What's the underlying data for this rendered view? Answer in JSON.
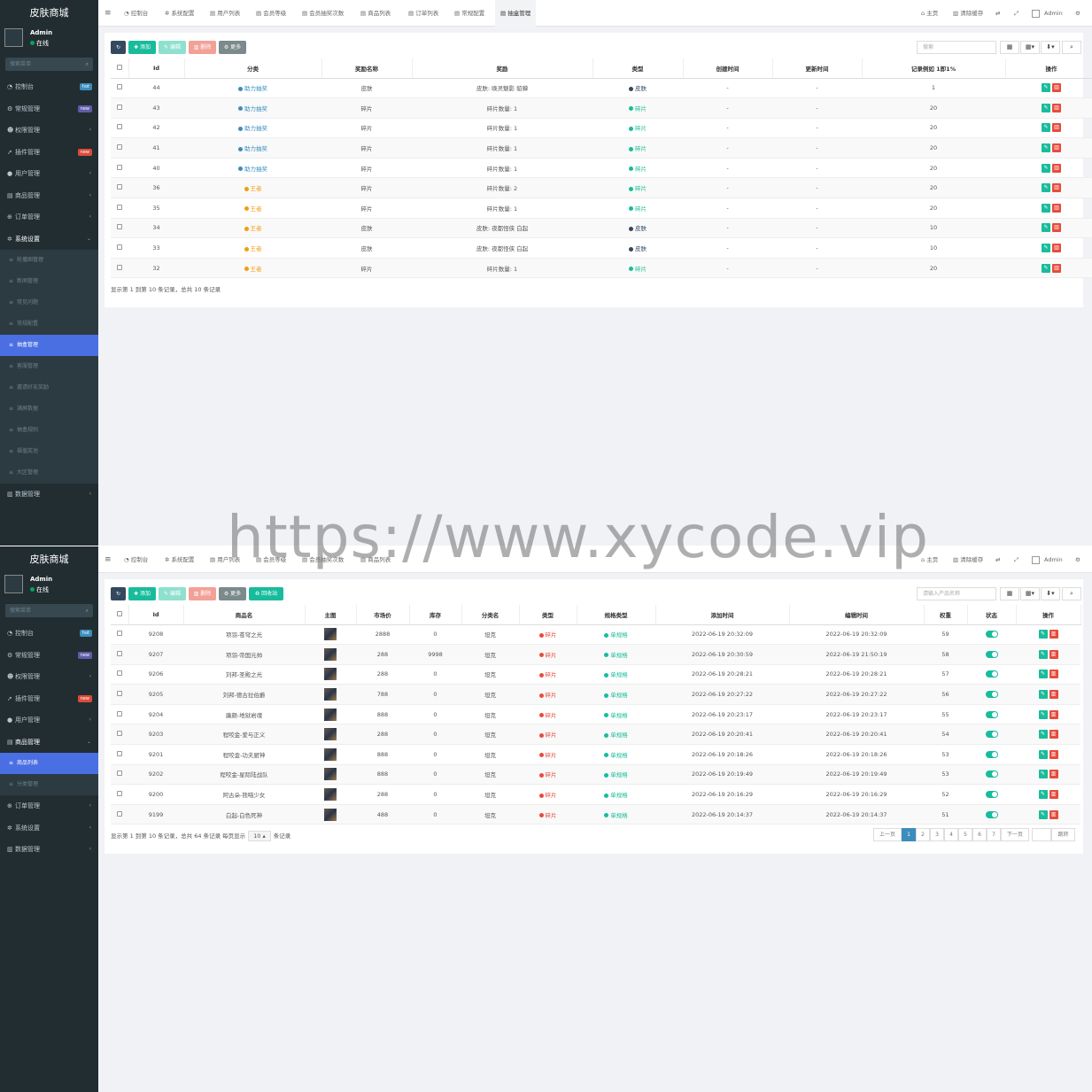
{
  "watermark": "https://www.xycode.vip",
  "colors": {
    "sidebar_bg": "#222d32",
    "active": "#4a6fe3",
    "teal": "#18bc9c",
    "blue": "#3c8dbc",
    "orange": "#f39c12",
    "red": "#e74c3c",
    "dark": "#34495e"
  },
  "p1": {
    "brand": "皮肤商城",
    "user": {
      "name": "Admin",
      "status": "在线"
    },
    "search_placeholder": "搜索菜单",
    "menu": [
      {
        "icon": "dashboard-icon",
        "label": "控制台",
        "badge": "hot",
        "badge_color": "#3c8dbc"
      },
      {
        "icon": "cogs-icon",
        "label": "常规管理",
        "badge": "new",
        "badge_color": "#605ca8"
      },
      {
        "icon": "users-icon",
        "label": "权限管理",
        "chev": "‹"
      },
      {
        "icon": "rocket-icon",
        "label": "插件管理",
        "badge": "new",
        "badge_color": "#dd4b39"
      },
      {
        "icon": "user-icon",
        "label": "用户管理",
        "chev": "‹"
      },
      {
        "icon": "shop-icon",
        "label": "商品管理",
        "chev": "‹"
      },
      {
        "icon": "cart-icon",
        "label": "订单管理",
        "chev": "‹"
      },
      {
        "icon": "gear-icon",
        "label": "系统设置",
        "chev": "⌄",
        "open": true
      }
    ],
    "submenu": [
      "轮播图管理",
      "新闻管理",
      "常见问题",
      "常规配置",
      "抽盒管理",
      "客服管理",
      "邀请好友奖励",
      "满屏数据",
      "抽盒规则",
      "福值奖池",
      "大区管理"
    ],
    "submenu_active": 4,
    "menu_after": [
      {
        "icon": "database-icon",
        "label": "数据管理",
        "chev": "‹"
      }
    ],
    "tabs": [
      "控制台",
      "系统配置",
      "用户列表",
      "会员等级",
      "会员抽奖次数",
      "商品列表",
      "订单列表",
      "常规配置",
      "抽盒管理"
    ],
    "tab_active": 8,
    "topright": {
      "home": "主页",
      "clear": "清除缓存",
      "admin": "Admin"
    },
    "buttons": {
      "add": "添加",
      "edit": "编辑",
      "del": "删除",
      "more": "更多"
    },
    "search_label": "搜索",
    "headers": [
      "Id",
      "分类",
      "奖励名称",
      "奖励",
      "类型",
      "创建时间",
      "更新时间",
      "记录例如 1即1%",
      "操作"
    ],
    "rows": [
      {
        "id": "44",
        "cat": "助力抽奖",
        "cat_color": "#3c8dbc",
        "name": "皮肤",
        "reward": "皮肤: 唤灵魅影 貂蝉",
        "type": "皮肤",
        "type_color": "#34495e",
        "created": "-",
        "updated": "-",
        "rate": "1"
      },
      {
        "id": "43",
        "cat": "助力抽奖",
        "cat_color": "#3c8dbc",
        "name": "碎片",
        "reward": "碎片数量: 1",
        "type": "碎片",
        "type_color": "#18bc9c",
        "created": "-",
        "updated": "-",
        "rate": "20"
      },
      {
        "id": "42",
        "cat": "助力抽奖",
        "cat_color": "#3c8dbc",
        "name": "碎片",
        "reward": "碎片数量: 1",
        "type": "碎片",
        "type_color": "#18bc9c",
        "created": "-",
        "updated": "-",
        "rate": "20"
      },
      {
        "id": "41",
        "cat": "助力抽奖",
        "cat_color": "#3c8dbc",
        "name": "碎片",
        "reward": "碎片数量: 1",
        "type": "碎片",
        "type_color": "#18bc9c",
        "created": "-",
        "updated": "-",
        "rate": "20"
      },
      {
        "id": "40",
        "cat": "助力抽奖",
        "cat_color": "#3c8dbc",
        "name": "碎片",
        "reward": "碎片数量: 1",
        "type": "碎片",
        "type_color": "#18bc9c",
        "created": "-",
        "updated": "-",
        "rate": "20"
      },
      {
        "id": "36",
        "cat": "王者",
        "cat_color": "#f39c12",
        "name": "碎片",
        "reward": "碎片数量: 2",
        "type": "碎片",
        "type_color": "#18bc9c",
        "created": "-",
        "updated": "-",
        "rate": "20"
      },
      {
        "id": "35",
        "cat": "王者",
        "cat_color": "#f39c12",
        "name": "碎片",
        "reward": "碎片数量: 1",
        "type": "碎片",
        "type_color": "#18bc9c",
        "created": "-",
        "updated": "-",
        "rate": "20"
      },
      {
        "id": "34",
        "cat": "王者",
        "cat_color": "#f39c12",
        "name": "皮肤",
        "reward": "皮肤: 夜都怪侠 白起",
        "type": "皮肤",
        "type_color": "#34495e",
        "created": "-",
        "updated": "-",
        "rate": "10"
      },
      {
        "id": "33",
        "cat": "王者",
        "cat_color": "#f39c12",
        "name": "皮肤",
        "reward": "皮肤: 夜都怪侠 白起",
        "type": "皮肤",
        "type_color": "#34495e",
        "created": "-",
        "updated": "-",
        "rate": "10"
      },
      {
        "id": "32",
        "cat": "王者",
        "cat_color": "#f39c12",
        "name": "碎片",
        "reward": "碎片数量: 1",
        "type": "碎片",
        "type_color": "#18bc9c",
        "created": "-",
        "updated": "-",
        "rate": "20"
      }
    ],
    "footer": "显示第 1 到第 10 条记录，总共 10 条记录"
  },
  "p2": {
    "brand": "皮肤商城",
    "user": {
      "name": "Admin",
      "status": "在线"
    },
    "search_placeholder": "搜索菜单",
    "menu": [
      {
        "icon": "dashboard-icon",
        "label": "控制台",
        "badge": "hot",
        "badge_color": "#3c8dbc"
      },
      {
        "icon": "cogs-icon",
        "label": "常规管理",
        "badge": "new",
        "badge_color": "#605ca8"
      },
      {
        "icon": "users-icon",
        "label": "权限管理",
        "chev": "‹"
      },
      {
        "icon": "rocket-icon",
        "label": "插件管理",
        "badge": "new",
        "badge_color": "#dd4b39"
      },
      {
        "icon": "user-icon",
        "label": "用户管理",
        "chev": "‹"
      },
      {
        "icon": "shop-icon",
        "label": "商品管理",
        "chev": "⌄",
        "open": true
      }
    ],
    "submenu": [
      "商品列表",
      "分类管理"
    ],
    "submenu_active": 0,
    "menu_after": [
      {
        "icon": "cart-icon",
        "label": "订单管理",
        "chev": "‹"
      },
      {
        "icon": "gear-icon",
        "label": "系统设置",
        "chev": "‹"
      },
      {
        "icon": "database-icon",
        "label": "数据管理",
        "chev": "‹"
      }
    ],
    "tabs": [
      "控制台",
      "系统配置",
      "用户列表",
      "会员等级",
      "会员抽奖次数",
      "商品列表"
    ],
    "tab_active": -1,
    "topright": {
      "home": "主页",
      "clear": "清除缓存",
      "admin": "Admin"
    },
    "buttons": {
      "add": "添加",
      "edit": "编辑",
      "del": "删除",
      "more": "更多",
      "recycle": "回收站"
    },
    "search_label": "请输入产品名称",
    "headers": [
      "Id",
      "商品名",
      "主图",
      "市场价",
      "库存",
      "分类名",
      "类型",
      "规格类型",
      "添加时间",
      "编辑时间",
      "权重",
      "状态",
      "操作"
    ],
    "rows": [
      {
        "id": "9208",
        "name": "项羽-苍穹之光",
        "price": "2888",
        "stock": "0",
        "cat": "坦克",
        "type": "碎片",
        "spec": "单规格",
        "added": "2022-06-19 20:32:09",
        "edited": "2022-06-19 20:32:09",
        "weight": "59"
      },
      {
        "id": "9207",
        "name": "项羽-帝国元帅",
        "price": "288",
        "stock": "9998",
        "cat": "坦克",
        "type": "碎片",
        "spec": "单规格",
        "added": "2022-06-19 20:30:59",
        "edited": "2022-06-19 21:50:19",
        "weight": "58"
      },
      {
        "id": "9206",
        "name": "刘邦-圣殿之光",
        "price": "288",
        "stock": "0",
        "cat": "坦克",
        "type": "碎片",
        "spec": "单规格",
        "added": "2022-06-19 20:28:21",
        "edited": "2022-06-19 20:28:21",
        "weight": "57"
      },
      {
        "id": "9205",
        "name": "刘邦-德古拉伯爵",
        "price": "788",
        "stock": "0",
        "cat": "坦克",
        "type": "碎片",
        "spec": "单规格",
        "added": "2022-06-19 20:27:22",
        "edited": "2022-06-19 20:27:22",
        "weight": "56"
      },
      {
        "id": "9204",
        "name": "廉颇-地狱岩魂",
        "price": "888",
        "stock": "0",
        "cat": "坦克",
        "type": "碎片",
        "spec": "单规格",
        "added": "2022-06-19 20:23:17",
        "edited": "2022-06-19 20:23:17",
        "weight": "55"
      },
      {
        "id": "9203",
        "name": "程咬金-爱与正义",
        "price": "288",
        "stock": "0",
        "cat": "坦克",
        "type": "碎片",
        "spec": "单规格",
        "added": "2022-06-19 20:20:41",
        "edited": "2022-06-19 20:20:41",
        "weight": "54"
      },
      {
        "id": "9201",
        "name": "程咬金-功夫厨神",
        "price": "888",
        "stock": "0",
        "cat": "坦克",
        "type": "碎片",
        "spec": "单规格",
        "added": "2022-06-19 20:18:26",
        "edited": "2022-06-19 20:18:26",
        "weight": "53"
      },
      {
        "id": "9202",
        "name": "程咬金-星际陆战队",
        "price": "888",
        "stock": "0",
        "cat": "坦克",
        "type": "碎片",
        "spec": "单规格",
        "added": "2022-06-19 20:19:49",
        "edited": "2022-06-19 20:19:49",
        "weight": "53"
      },
      {
        "id": "9200",
        "name": "阿古朵-熊喵少女",
        "price": "288",
        "stock": "0",
        "cat": "坦克",
        "type": "碎片",
        "spec": "单规格",
        "added": "2022-06-19 20:16:29",
        "edited": "2022-06-19 20:16:29",
        "weight": "52"
      },
      {
        "id": "9199",
        "name": "白起-白色死神",
        "price": "488",
        "stock": "0",
        "cat": "坦克",
        "type": "碎片",
        "spec": "单规格",
        "added": "2022-06-19 20:14:37",
        "edited": "2022-06-19 20:14:37",
        "weight": "51"
      }
    ],
    "footer": {
      "text": "显示第 1 到第 10 条记录，总共 64 条记录 每页显示",
      "per_page": "10",
      "suffix": "条记录"
    },
    "pagination": {
      "prev": "上一页",
      "pages": [
        "1",
        "2",
        "3",
        "4",
        "5",
        "6",
        "7"
      ],
      "active": "1",
      "next": "下一页",
      "jump": "跳转"
    }
  }
}
